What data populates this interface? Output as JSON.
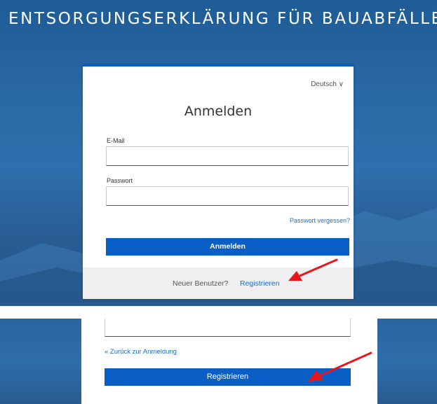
{
  "app_title": "ENTSORGUNGSERKLÄRUNG FÜR BAUABFÄLLE",
  "login": {
    "language_selector": "Deutsch ∨",
    "heading": "Anmelden",
    "email_label": "E-Mail",
    "email_value": "",
    "password_label": "Passwort",
    "password_value": "",
    "forgot_password_link": "Passwort vergessen?",
    "submit_button": "Anmelden",
    "footer_text": "Neuer Benutzer?",
    "register_link": "Registrieren"
  },
  "register": {
    "back_link": "« Zurück zur Anmeldung",
    "submit_button": "Registrieren"
  },
  "colors": {
    "background_blue": "#2a6aa7",
    "accent": "#0a5fc6",
    "link": "#1a6fc9",
    "annotation_arrow": "#e8161b"
  },
  "icons": {
    "annotation": "red-arrow-icon",
    "dropdown": "chevron-down-icon"
  }
}
